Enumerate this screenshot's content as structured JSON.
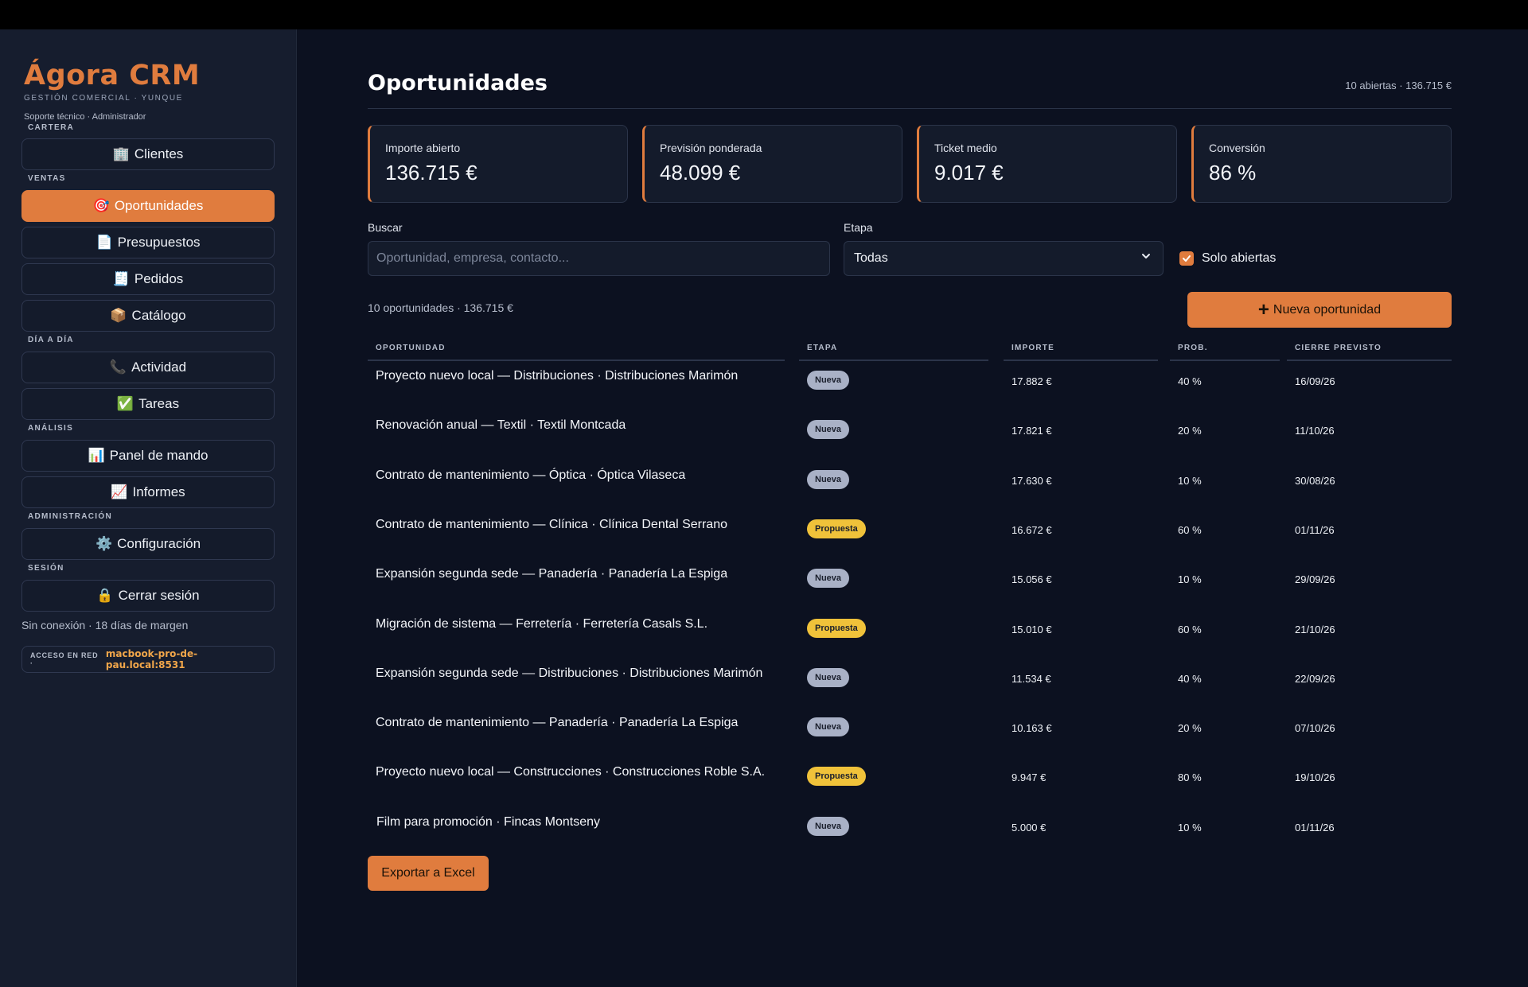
{
  "app": {
    "brand": "Ágora CRM",
    "subtitle": "GESTIÓN COMERCIAL · YUNQUE",
    "user": "Soporte técnico · Administrador"
  },
  "sidebar": {
    "sections": {
      "cartera": "CARTERA",
      "ventas": "VENTAS",
      "dia": "DÍA A DÍA",
      "analisis": "ANÁLISIS",
      "administracion": "ADMINISTRACIÓN",
      "sesion": "SESIÓN"
    },
    "items": [
      {
        "label": "Clientes",
        "icon": "🏢",
        "icon_name": "building-icon"
      },
      {
        "label": "Oportunidades",
        "icon": "🎯",
        "icon_name": "target-icon",
        "active": true
      },
      {
        "label": "Presupuestos",
        "icon": "📄",
        "icon_name": "document-icon"
      },
      {
        "label": "Pedidos",
        "icon": "🧾",
        "icon_name": "receipt-icon"
      },
      {
        "label": "Catálogo",
        "icon": "📦",
        "icon_name": "package-icon"
      },
      {
        "label": "Actividad",
        "icon": "📞",
        "icon_name": "phone-icon"
      },
      {
        "label": "Tareas",
        "icon": "✅",
        "icon_name": "checkmark-icon"
      },
      {
        "label": "Panel de mando",
        "icon": "📊",
        "icon_name": "bar-chart-icon"
      },
      {
        "label": "Informes",
        "icon": "📈",
        "icon_name": "line-chart-icon"
      },
      {
        "label": "Configuración",
        "icon": "⚙️",
        "icon_name": "gear-icon"
      },
      {
        "label": "Cerrar sesión",
        "icon": "🔒",
        "icon_name": "lock-icon"
      }
    ],
    "offline_status": "Sin conexión · 18 días de margen",
    "network_label": "ACCESO EN RED ·",
    "network_value": "macbook-pro-de-pau.local:8531"
  },
  "header": {
    "title": "Oportunidades",
    "summary": "10 abiertas · 136.715 €"
  },
  "kpis": [
    {
      "label": "Importe abierto",
      "value": "136.715 €"
    },
    {
      "label": "Previsión ponderada",
      "value": "48.099 €"
    },
    {
      "label": "Ticket medio",
      "value": "9.017 €"
    },
    {
      "label": "Conversión",
      "value": "86 %"
    }
  ],
  "filters": {
    "search_label": "Buscar",
    "search_placeholder": "Oportunidad, empresa, contacto...",
    "stage_label": "Etapa",
    "stage_value": "Todas",
    "only_open_label": "Solo abiertas",
    "only_open_checked": true
  },
  "list": {
    "count": "10 oportunidades · 136.715 €",
    "new_button": "Nueva oportunidad",
    "columns": [
      "OPORTUNIDAD",
      "ETAPA",
      "IMPORTE",
      "PROB.",
      "CIERRE PREVISTO"
    ],
    "rows": [
      {
        "name": "Proyecto nuevo local — Distribuciones · Distribuciones Marimón",
        "stage": "Nueva",
        "amount": "17.882 €",
        "prob": "40 %",
        "close": "16/09/26"
      },
      {
        "name": "Renovación anual — Textil · Textil Montcada",
        "stage": "Nueva",
        "amount": "17.821 €",
        "prob": "20 %",
        "close": "11/10/26"
      },
      {
        "name": "Contrato de mantenimiento — Óptica · Óptica Vilaseca",
        "stage": "Nueva",
        "amount": "17.630 €",
        "prob": "10 %",
        "close": "30/08/26"
      },
      {
        "name": "Contrato de mantenimiento — Clínica · Clínica Dental Serrano",
        "stage": "Propuesta",
        "amount": "16.672 €",
        "prob": "60 %",
        "close": "01/11/26"
      },
      {
        "name": "Expansión segunda sede — Panadería · Panadería La Espiga",
        "stage": "Nueva",
        "amount": "15.056 €",
        "prob": "10 %",
        "close": "29/09/26"
      },
      {
        "name": "Migración de sistema — Ferretería · Ferretería Casals S.L.",
        "stage": "Propuesta",
        "amount": "15.010 €",
        "prob": "60 %",
        "close": "21/10/26"
      },
      {
        "name": "Expansión segunda sede — Distribuciones · Distribuciones Marimón",
        "stage": "Nueva",
        "amount": "11.534 €",
        "prob": "40 %",
        "close": "22/09/26"
      },
      {
        "name": "Contrato de mantenimiento — Panadería · Panadería La Espiga",
        "stage": "Nueva",
        "amount": "10.163 €",
        "prob": "20 %",
        "close": "07/10/26"
      },
      {
        "name": "Proyecto nuevo local — Construcciones · Construcciones Roble S.A.",
        "stage": "Propuesta",
        "amount": "9.947 €",
        "prob": "80 %",
        "close": "19/10/26"
      },
      {
        "name": "Film para promoción · Fincas Montseny",
        "stage": "Nueva",
        "amount": "5.000 €",
        "prob": "10 %",
        "close": "01/11/26"
      }
    ],
    "stage_colors": {
      "Nueva": "#a9b1c6",
      "Propuesta": "#f0c23a"
    },
    "export_button": "Exportar a Excel"
  },
  "colors": {
    "accent": "#e07c3e",
    "background": "#0c1120",
    "sidebar": "#161d2e"
  }
}
